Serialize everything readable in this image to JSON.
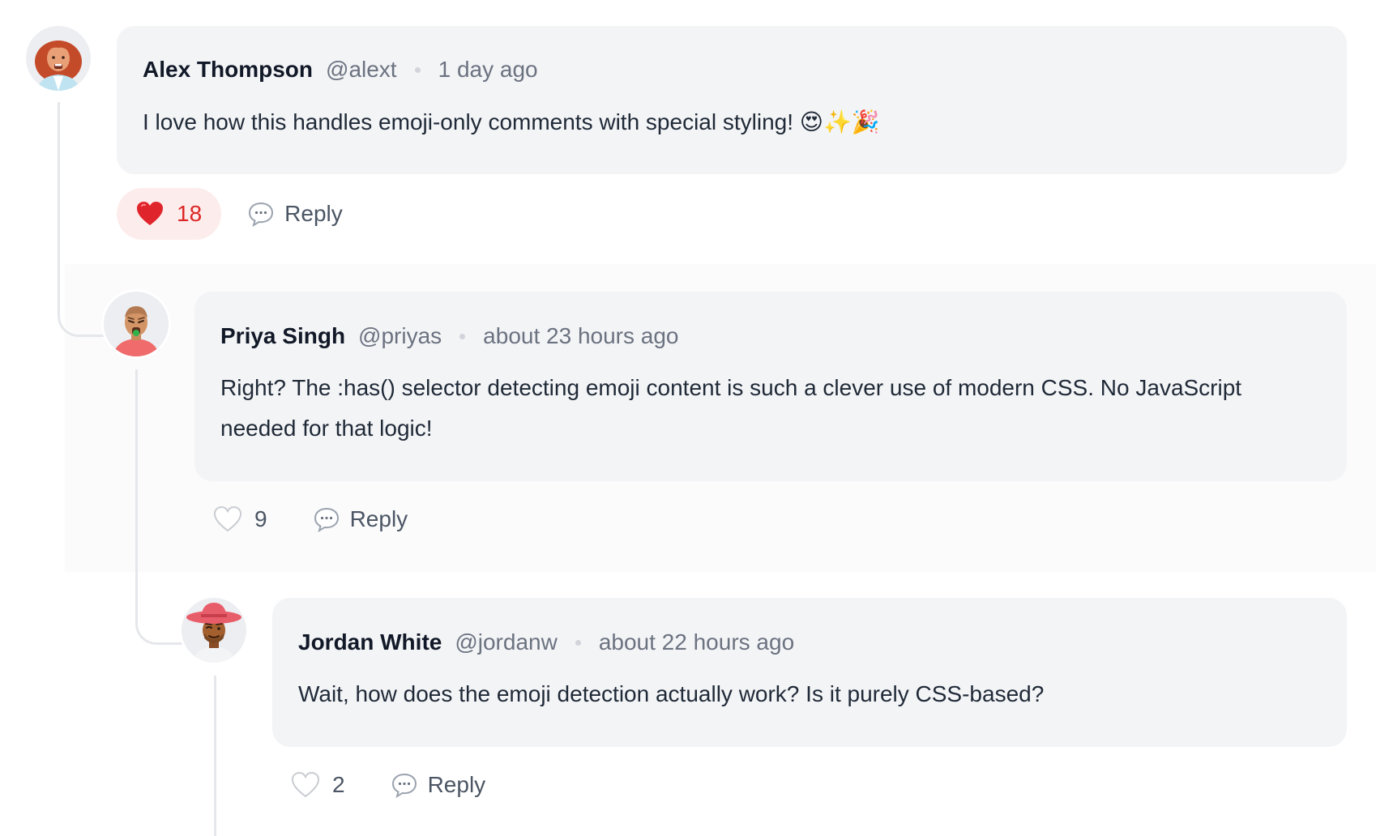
{
  "comments": [
    {
      "author": "Alex Thompson",
      "handle": "@alext",
      "time": "1 day ago",
      "text": "I love how this handles emoji-only comments with special styling! 😍✨🎉",
      "likes": "18",
      "liked": true,
      "reply_label": "Reply",
      "avatar_icon": "woman-red-hair-avatar"
    },
    {
      "author": "Priya Singh",
      "handle": "@priyas",
      "time": "about 23 hours ago",
      "text": "Right? The :has() selector detecting emoji content is such a clever use of modern CSS. No JavaScript needed for that logic!",
      "likes": "9",
      "liked": false,
      "reply_label": "Reply",
      "avatar_icon": "person-green-tongue-avatar"
    },
    {
      "author": "Jordan White",
      "handle": "@jordanw",
      "time": "about 22 hours ago",
      "text": "Wait, how does the emoji detection actually work? Is it purely CSS-based?",
      "likes": "2",
      "liked": false,
      "reply_label": "Reply",
      "avatar_icon": "man-red-hat-avatar"
    }
  ],
  "colors": {
    "bubble": "#f3f4f6",
    "liked_bg": "#fdecec",
    "liked_text": "#dc2626",
    "muted_text": "#6b7280",
    "thread_line": "#e5e7eb"
  }
}
